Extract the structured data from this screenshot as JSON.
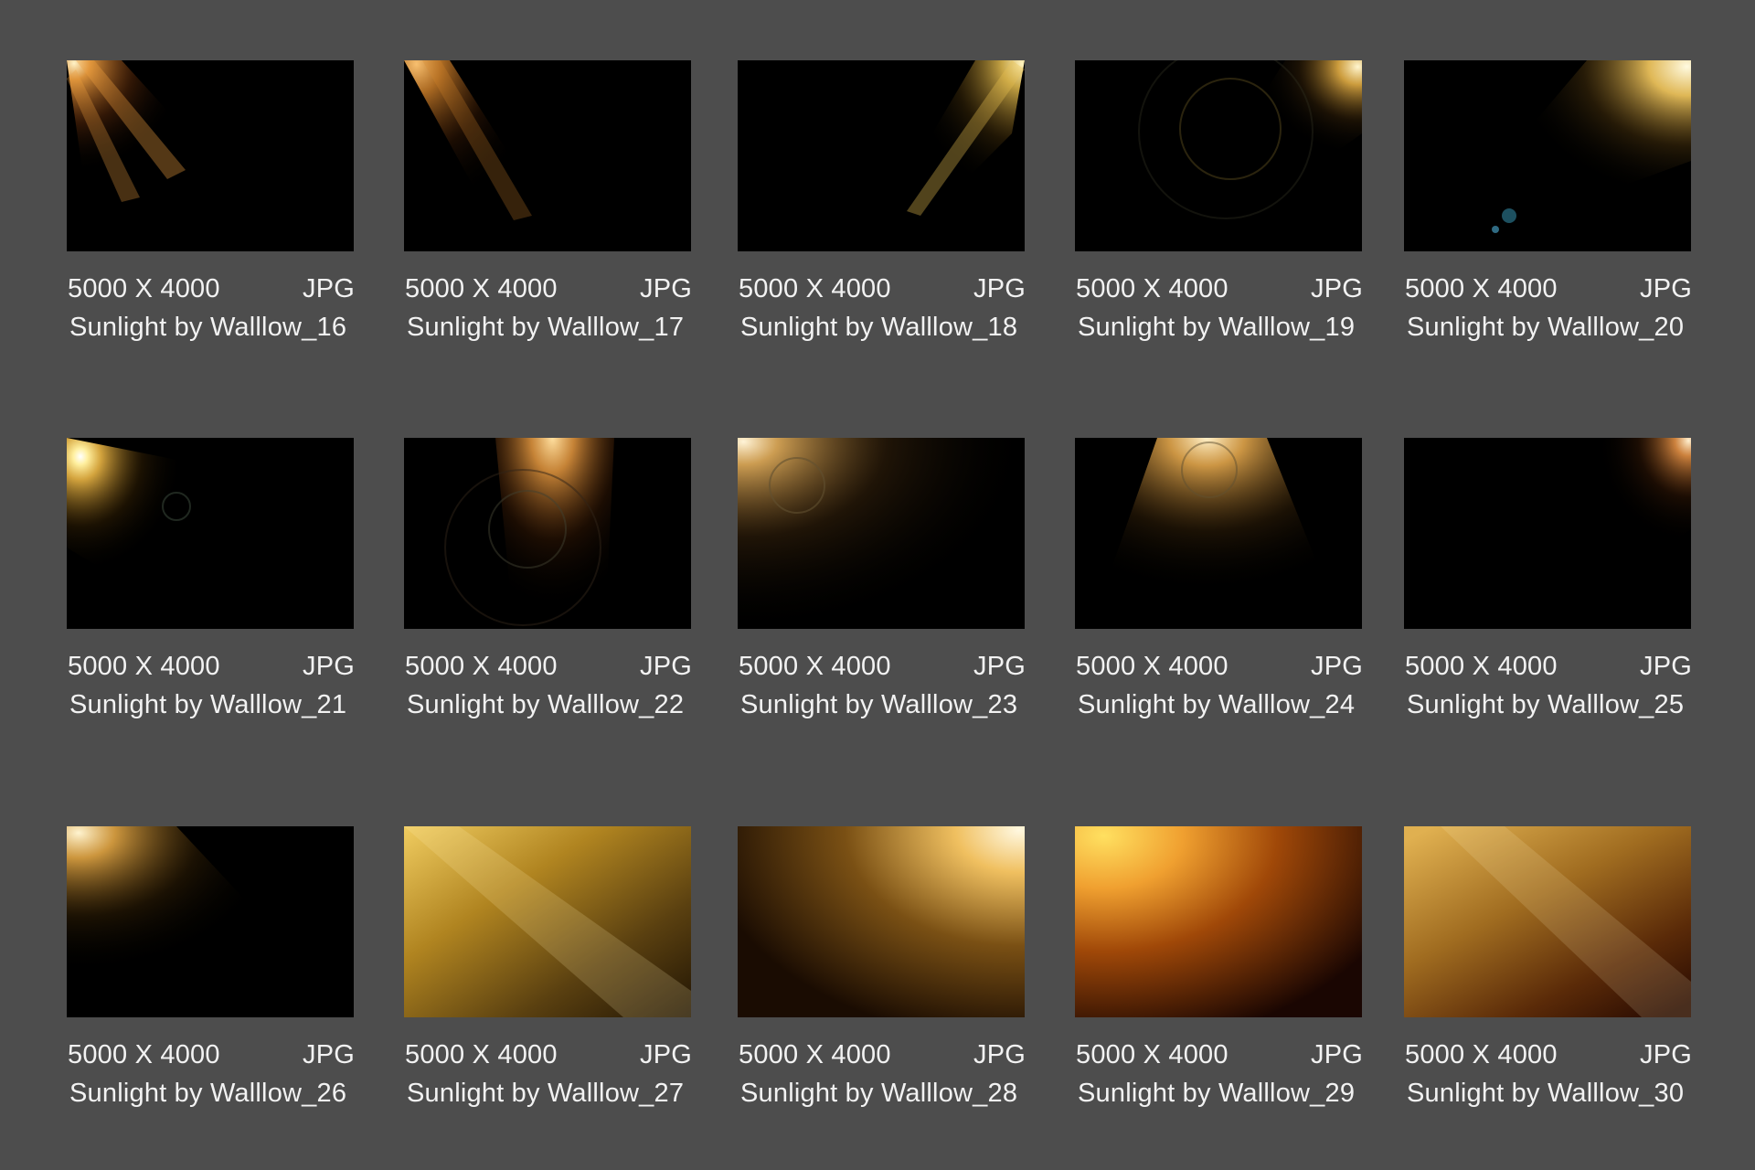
{
  "items": [
    {
      "dimensions": "5000 X 4000",
      "format": "JPG",
      "title": "Sunlight by Walllow_16",
      "light_color": "#f0a040"
    },
    {
      "dimensions": "5000 X 4000",
      "format": "JPG",
      "title": "Sunlight by Walllow_17",
      "light_color": "#d8862c"
    },
    {
      "dimensions": "5000 X 4000",
      "format": "JPG",
      "title": "Sunlight by Walllow_18",
      "light_color": "#e8c050"
    },
    {
      "dimensions": "5000 X 4000",
      "format": "JPG",
      "title": "Sunlight by Walllow_19",
      "light_color": "#f0b848"
    },
    {
      "dimensions": "5000 X 4000",
      "format": "JPG",
      "title": "Sunlight by Walllow_20",
      "light_color": "#f8cc60"
    },
    {
      "dimensions": "5000 X 4000",
      "format": "JPG",
      "title": "Sunlight by Walllow_21",
      "light_color": "#f8c048"
    },
    {
      "dimensions": "5000 X 4000",
      "format": "JPG",
      "title": "Sunlight by Walllow_22",
      "light_color": "#e89a40"
    },
    {
      "dimensions": "5000 X 4000",
      "format": "JPG",
      "title": "Sunlight by Walllow_23",
      "light_color": "#f0b860"
    },
    {
      "dimensions": "5000 X 4000",
      "format": "JPG",
      "title": "Sunlight by Walllow_24",
      "light_color": "#f0b050"
    },
    {
      "dimensions": "5000 X 4000",
      "format": "JPG",
      "title": "Sunlight by Walllow_25",
      "light_color": "#f09848"
    },
    {
      "dimensions": "5000 X 4000",
      "format": "JPG",
      "title": "Sunlight by Walllow_26",
      "light_color": "#f0b048"
    },
    {
      "dimensions": "5000 X 4000",
      "format": "JPG",
      "title": "Sunlight by Walllow_27",
      "light_color": "#e0b040"
    },
    {
      "dimensions": "5000 X 4000",
      "format": "JPG",
      "title": "Sunlight by Walllow_28",
      "light_color": "#f0c060"
    },
    {
      "dimensions": "5000 X 4000",
      "format": "JPG",
      "title": "Sunlight by Walllow_29",
      "light_color": "#f0a030"
    },
    {
      "dimensions": "5000 X 4000",
      "format": "JPG",
      "title": "Sunlight by Walllow_30",
      "light_color": "#d8a048"
    }
  ]
}
